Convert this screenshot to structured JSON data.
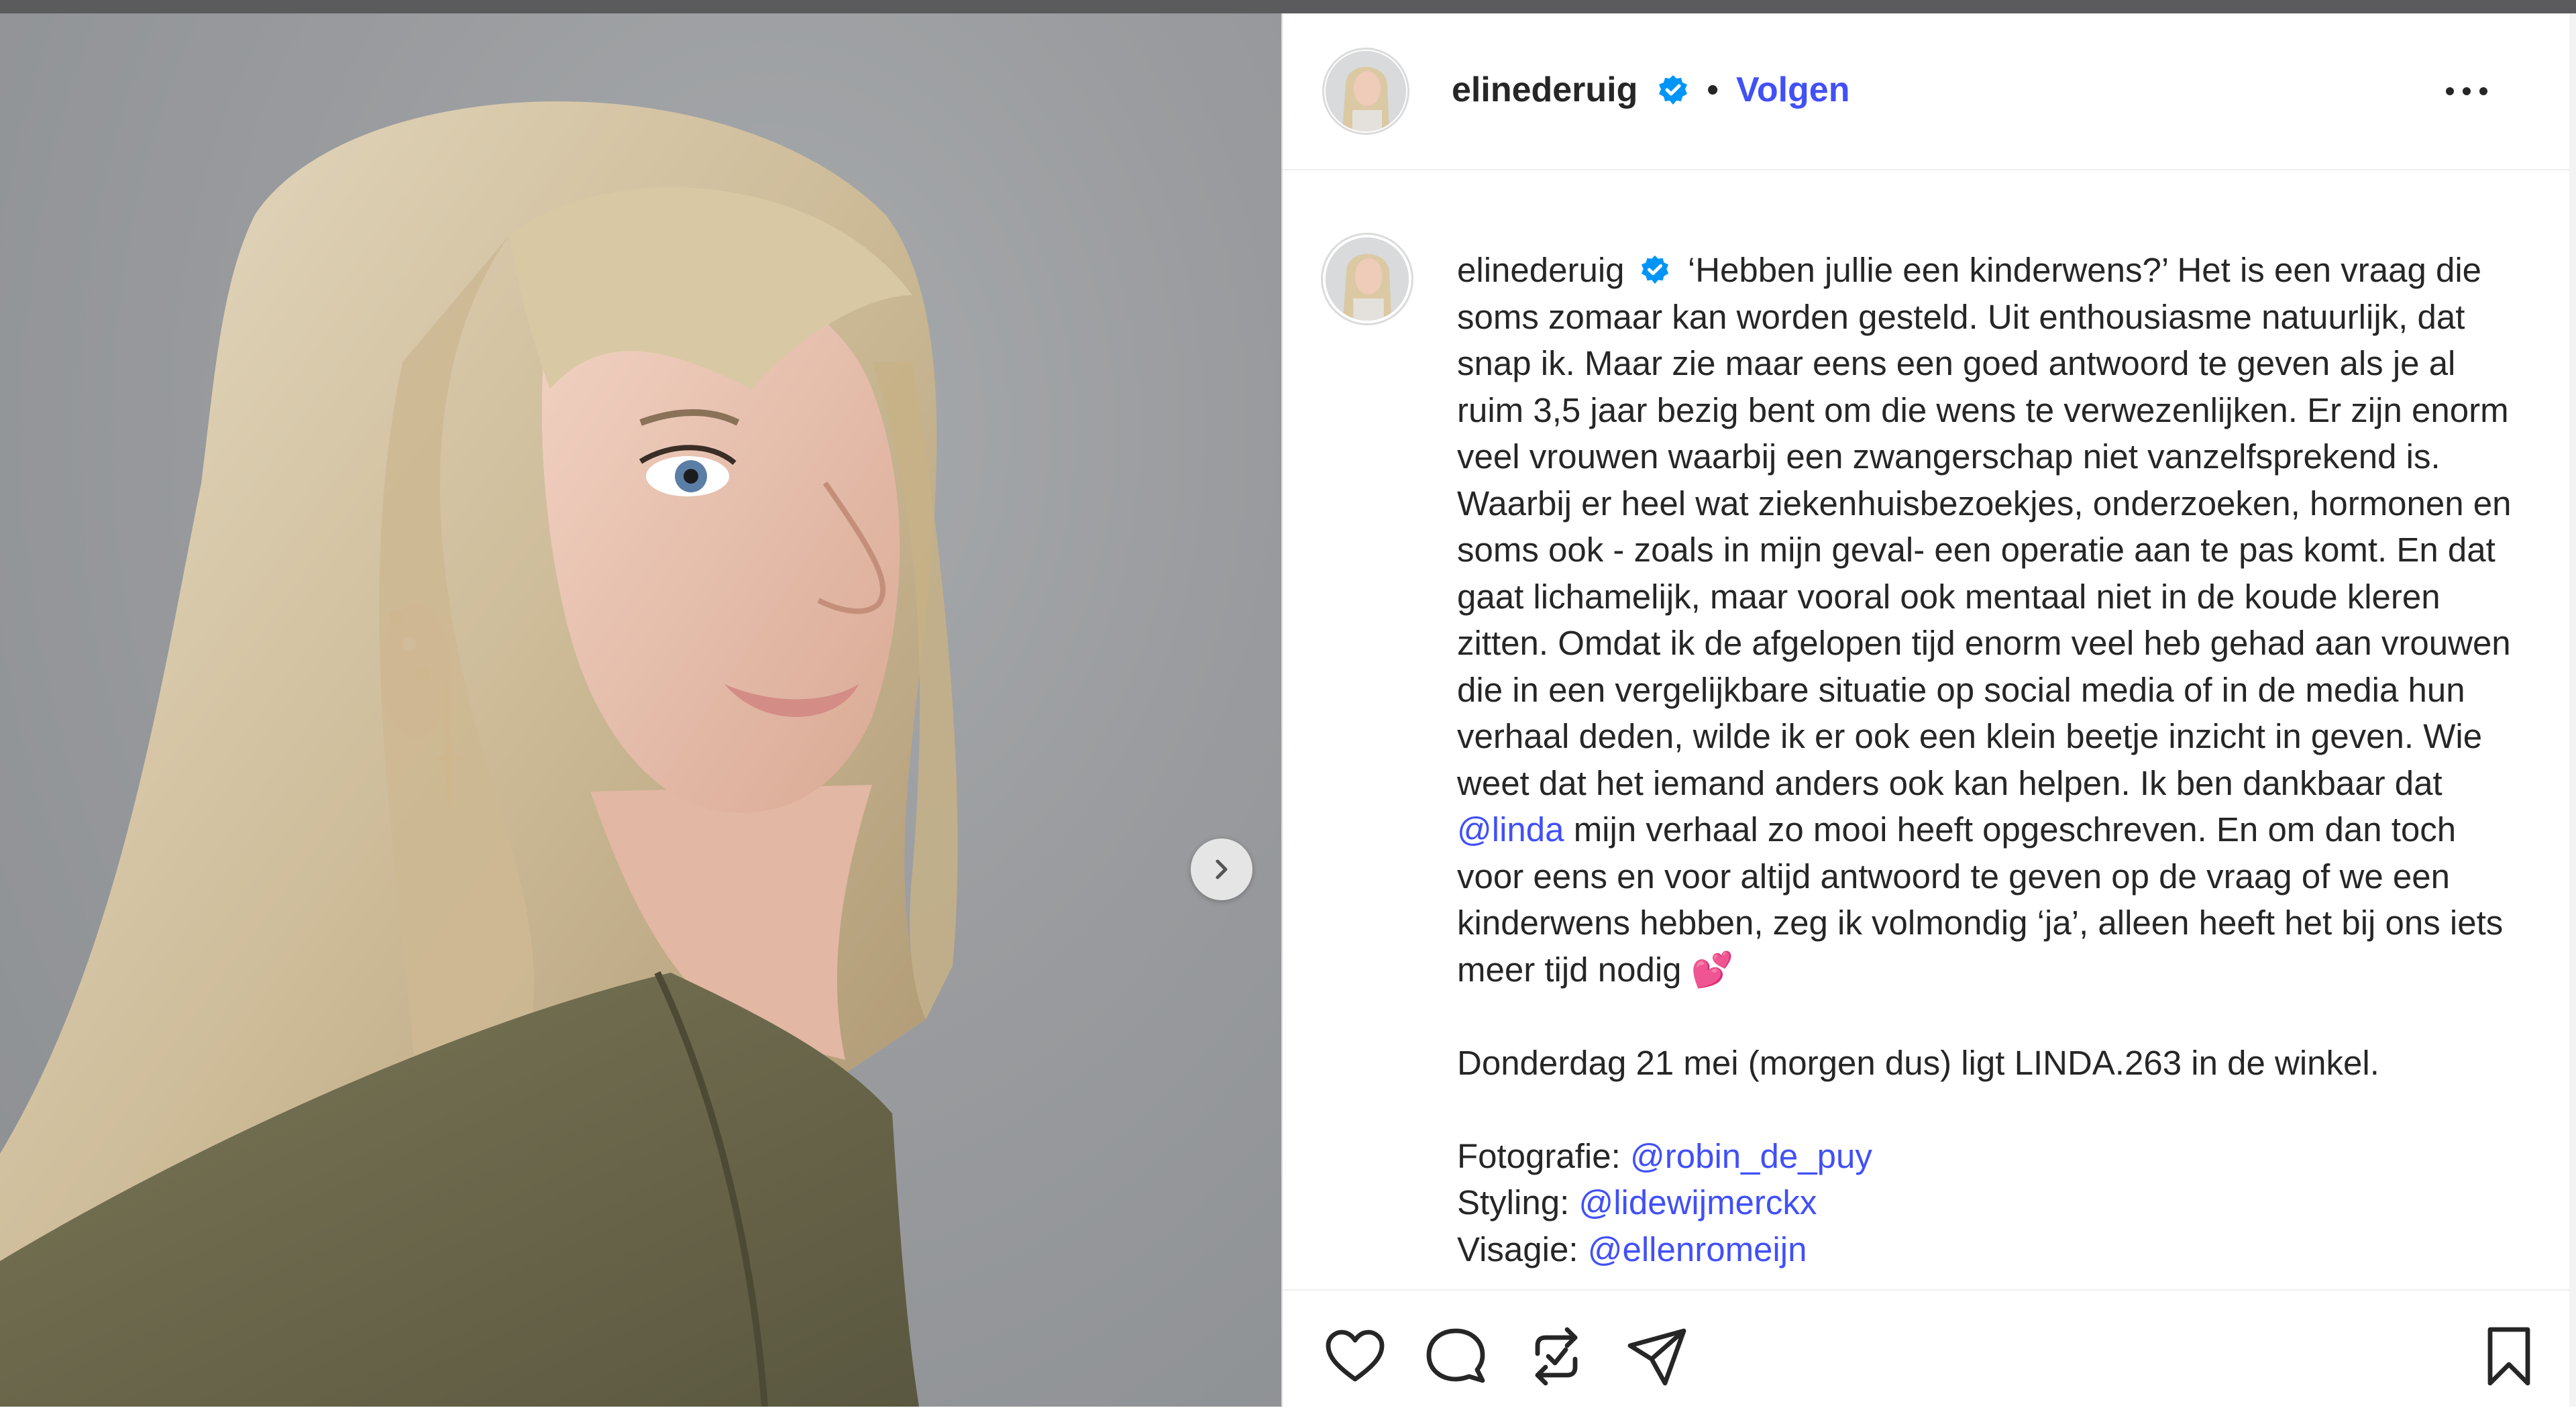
{
  "post": {
    "username": "elinederuig",
    "follow_label": "Volgen",
    "separator": "•"
  },
  "caption": {
    "username": "elinederuig",
    "part1": "‘Hebben jullie een kinderwens?’ Het is een vraag die soms zomaar kan worden gesteld. Uit enthousiasme natuurlijk, dat snap ik. Maar zie maar eens een goed antwoord te geven als je al ruim 3,5 jaar bezig bent om die wens te verwezenlijken. Er zijn enorm veel vrouwen waarbij een zwangerschap niet vanzelfsprekend is. Waarbij er heel wat ziekenhuisbezoekjes, onderzoeken, hormonen en soms ook - zoals in mijn geval- een operatie aan te pas komt. En dat gaat lichamelijk, maar vooral ook mentaal niet in de koude kleren zitten. Omdat ik de afgelopen tijd enorm veel heb gehad aan vrouwen die in een vergelijkbare situatie op social media of in de media hun verhaal deden, wilde ik er ook een klein beetje inzicht in geven. Wie weet dat het iemand anders ook kan helpen. Ik ben dankbaar dat",
    "mention_linda": "@linda",
    "part2": "mijn verhaal zo mooi heeft opgeschreven. En om dan toch voor eens en voor altijd antwoord te geven op de vraag of we een kinderwens hebben, zeg ik volmondig ‘ja’, alleen heeft het bij ons iets meer tijd nodig",
    "emoji": "💕",
    "para2": "Donderdag 21 mei (morgen dus) ligt LINDA.263 in de winkel.",
    "credits": [
      {
        "label": "Fotografie:",
        "handle": "@robin_de_puy"
      },
      {
        "label": "Styling:",
        "handle": "@lidewijmerckx"
      },
      {
        "label": "Visagie:",
        "handle": "@ellenromeijn"
      }
    ]
  },
  "icons": {
    "verified": "verified-badge-icon",
    "more": "more-options-icon",
    "next": "chevron-right-icon",
    "like": "heart-icon",
    "comment": "comment-bubble-icon",
    "repost": "repost-icon",
    "share": "paper-plane-icon",
    "save": "bookmark-icon"
  },
  "colors": {
    "link": "#4150f7",
    "verified": "#0095f6",
    "text": "#262626",
    "jacket": "#6d6a4c"
  }
}
